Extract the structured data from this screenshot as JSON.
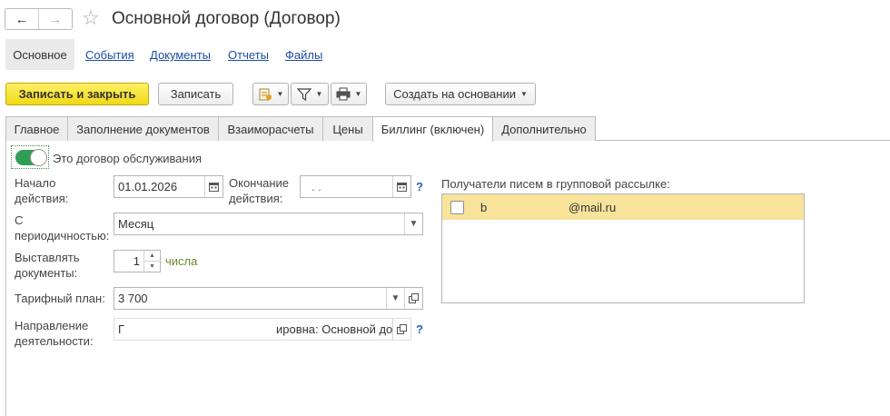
{
  "window": {
    "title": "Основной договор (Договор)"
  },
  "nav": {
    "back_icon": "←",
    "forward_icon": "→",
    "favorite_icon": "☆"
  },
  "sections": {
    "active": "Основное",
    "links": [
      "События",
      "Документы",
      "Отчеты",
      "Файлы"
    ]
  },
  "commands": {
    "save_close": "Записать и закрыть",
    "save": "Записать",
    "create_based_on": "Создать на основании"
  },
  "tabs": [
    "Главное",
    "Заполнение документов",
    "Взаиморасчеты",
    "Цены",
    "Биллинг (включен)",
    "Дополнительно"
  ],
  "form": {
    "service_contract_label": "Это договор обслуживания",
    "start_label_1": "Начало",
    "start_label_2": "действия:",
    "start_value": "01.01.2026",
    "end_label_1": "Окончание",
    "end_label_2": "действия:",
    "end_value": ".   .",
    "periodicity_label_1": "С",
    "periodicity_label_2": "периодичностью:",
    "periodicity_value": "Месяц",
    "issue_label_1": "Выставлять",
    "issue_label_2": "документы:",
    "issue_value": "1",
    "issue_unit": "числа",
    "tariff_label": "Тарифный план:",
    "tariff_value": "3 700",
    "direction_label_1": "Направление",
    "direction_label_2": "деятельности:",
    "direction_value_start": "Г",
    "direction_value_end": "ировна: Основной до",
    "help_mark": "?"
  },
  "recipients": {
    "label": "Получатели писем в групповой рассылке:",
    "items": [
      {
        "email_start": "b",
        "email_end": "@mail.ru"
      }
    ]
  }
}
